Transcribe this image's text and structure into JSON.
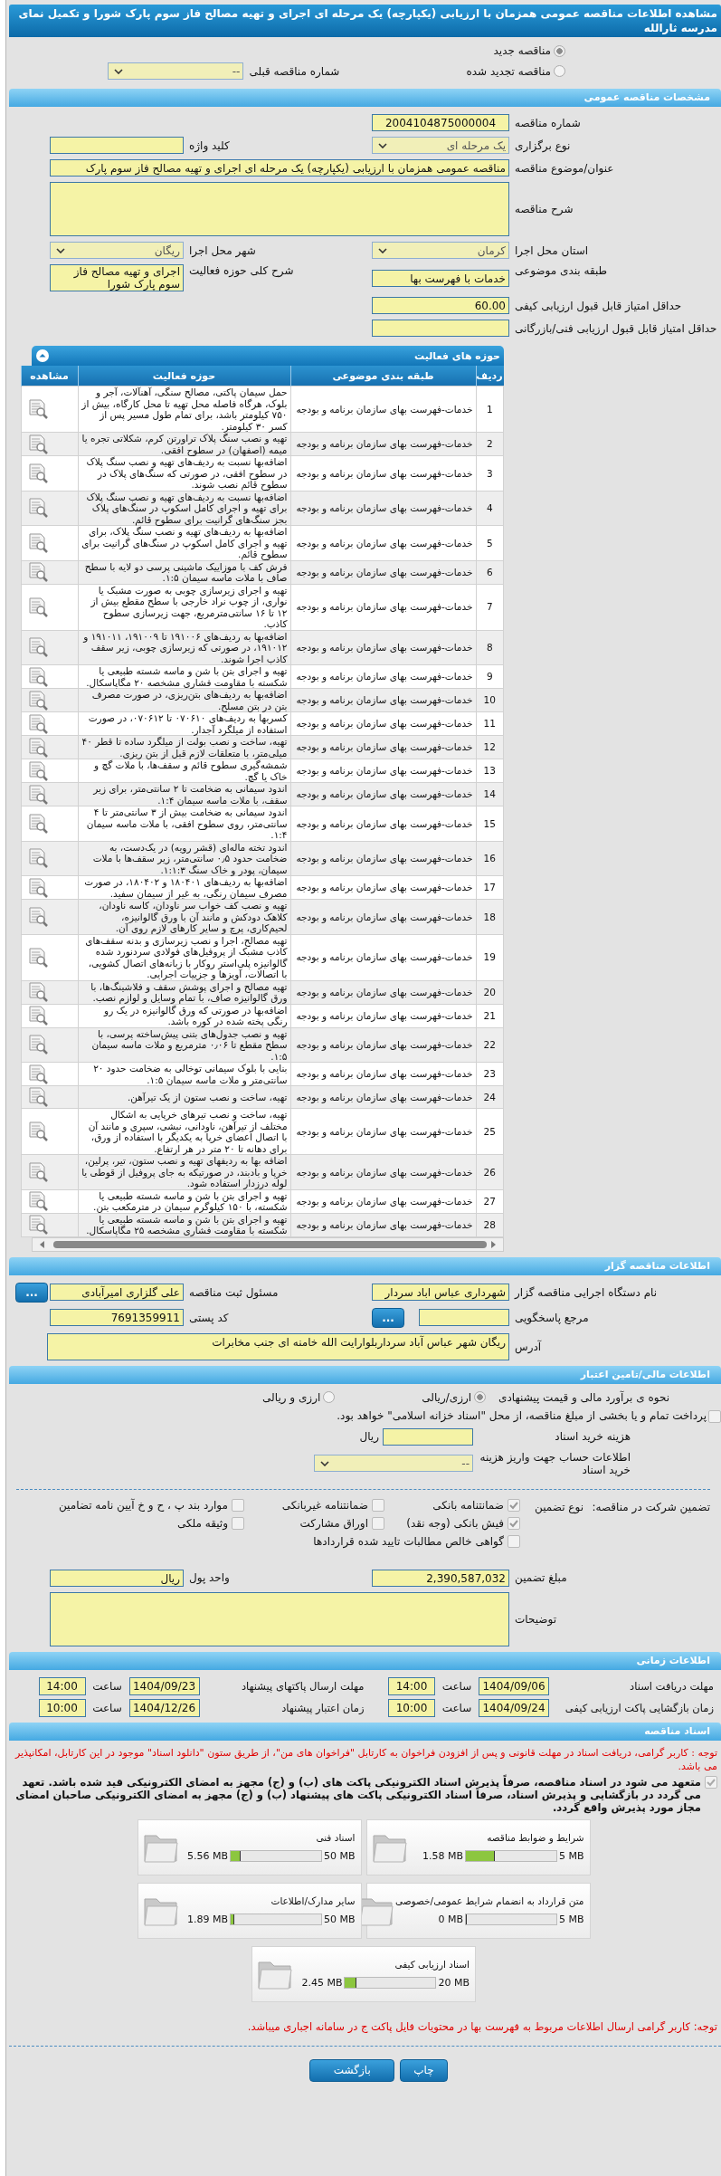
{
  "title": "مشاهده اطلاعات مناقصه عمومی همزمان با ارزیابی (یکپارچه) یک مرحله ای اجرای و تهیه مصالح فاز سوم پارک شورا و تکمیل نمای مدرسه ثارالله",
  "tender_kind": [
    {
      "label": "مناقصه جدید",
      "selected": true
    },
    {
      "label": "مناقصه تجدید شده",
      "selected": false
    }
  ],
  "previous_tender": {
    "label": "شماره مناقصه قبلی",
    "value": "--"
  },
  "general": {
    "title": "مشخصات مناقصه عمومی",
    "tender_number": {
      "label": "شماره مناقصه",
      "value": "2004104875000004"
    },
    "holding_type": {
      "label": "نوع برگزاری",
      "value": "یک مرحله ای"
    },
    "keyword": {
      "label": "کلید واژه"
    },
    "subject": {
      "label": "عنوان/موضوع مناقصه",
      "value": "مناقصه عمومی همزمان با ارزیابی (یکپارچه) یک مرحله ای اجرای و تهیه مصالح فاز سوم پارک"
    },
    "description": {
      "label": "شرح مناقصه"
    },
    "province": {
      "label": "استان محل اجرا",
      "value": "کرمان"
    },
    "city": {
      "label": "شهر محل اجرا",
      "value": "ریگان"
    },
    "category": {
      "label": "طبقه بندی موضوعی",
      "value": "خدمات با فهرست بها"
    },
    "activity_summary": {
      "label": "شرح کلی حوزه فعالیت",
      "value": "اجرای و تهیه مصالح فاز سوم پارک شورا"
    },
    "min_quality_score": {
      "label": "حداقل امتیاز قابل قبول ارزیابی کیفی",
      "value": "60.00"
    },
    "min_technical_score": {
      "label": "حداقل امتیاز قابل قبول ارزیابی فنی/بازرگانی"
    }
  },
  "activities": {
    "title": "حوزه های فعالیت",
    "columns": [
      "ردیف",
      "طبقه بندی موضوعی",
      "حوزه فعالیت",
      "مشاهده"
    ],
    "rows": [
      {
        "row": "1",
        "category": "خدمات-فهرست بهای سازمان برنامه و بودجه",
        "activity": "حمل سیمان پاکتی، مصالح سنگی، آهنآلات، آجر و بلوک، هرگاه فاصله محل تهیه تا محل کارگاه، بیش از ۷۵۰ کیلومتر باشد، برای تمام طول مسیر پس از کسر ۳۰ کیلومتر."
      },
      {
        "row": "2",
        "category": "خدمات-فهرست بهای سازمان برنامه و بودجه",
        "activity": "تهیه و نصب سنگ پلاک تراورتن کرم، شکلاتی تجره یا میمه (اصفهان) در سطوح افقی."
      },
      {
        "row": "3",
        "category": "خدمات-فهرست بهای سازمان برنامه و بودجه",
        "activity": "اضافه‌بها نسبت به ردیف‌های تهیه و نصب سنگ پلاک در سطوح افقی، در صورتی که سنگ‌های پلاک در سطوح قائم نصب شوند."
      },
      {
        "row": "4",
        "category": "خدمات-فهرست بهای سازمان برنامه و بودجه",
        "activity": "اضافه‌بها نسبت به ردیف‌های تهیه و نصب سنگ پلاک برای تهیه و اجرای کامل اسکوپ در سنگ‌های پلاک بجز سنگ‌های گرانیت برای سطوح قائم."
      },
      {
        "row": "5",
        "category": "خدمات-فهرست بهای سازمان برنامه و بودجه",
        "activity": "اضافه‌بها به ردیف‌های تهیه و نصب سنگ پلاک، برای تهیه و اجرای کامل اسکوپ در سنگ‌های گرانیت برای سطوح قائم."
      },
      {
        "row": "6",
        "category": "خدمات-فهرست بهای سازمان برنامه و بودجه",
        "activity": "فرش کف با موزاییک ماشینی پرسی دو لایه با سطح صاف با ملات ماسه سیمان ۱:۵."
      },
      {
        "row": "7",
        "category": "خدمات-فهرست بهای سازمان برنامه و بودجه",
        "activity": "تهیه و اجرای زیرسازی چوبی به صورت مشبک یا نواری، از چوب نراد خارجی با سطح مقطع بیش از ۱۲ تا ۱۶ سانتی‌مترمربع، جهت زیرسازی سطوح کاذب."
      },
      {
        "row": "8",
        "category": "خدمات-فهرست بهای سازمان برنامه و بودجه",
        "activity": "اضافه‌بها به ردیف‌های ۱۹۱۰۰۶ تا ۱۹۱۰۰۹، ۱۹۱۰۱۱ و ۱۹۱۰۱۲، در صورتی که زیرسازی چوبی، زیر سقف کاذب اجرا شوند."
      },
      {
        "row": "9",
        "category": "خدمات-فهرست بهای سازمان برنامه و بودجه",
        "activity": "تهیه و اجرای بتن با شن و ماسه شسته طبیعی یا شکسته با مقاومت فشاری مشخصه ۲۰ مگاپاسکال."
      },
      {
        "row": "10",
        "category": "خدمات-فهرست بهای سازمان برنامه و بودجه",
        "activity": "اضافه‌بها به ردیف‌های بتن‌ریزی، در صورت مصرف بتن در بتن مسلح."
      },
      {
        "row": "11",
        "category": "خدمات-فهرست بهای سازمان برنامه و بودجه",
        "activity": "کسربها به ردیف‌های ۰۷۰۶۱۰ تا ۰۷۰۶۱۲، در صورت استفاده از میلگرد آجدار."
      },
      {
        "row": "12",
        "category": "خدمات-فهرست بهای سازمان برنامه و بودجه",
        "activity": "تهیه، ساخت و نصب بولت از میلگرد ساده تا قطر ۴۰ میلی‌متر، با متعلقات لازم قبل از بتن ریزی."
      },
      {
        "row": "13",
        "category": "خدمات-فهرست بهای سازمان برنامه و بودجه",
        "activity": "شمشه‌گیری سطوح قائم و سقف‌ها، با ملات گچ و خاک یا گچ."
      },
      {
        "row": "14",
        "category": "خدمات-فهرست بهای سازمان برنامه و بودجه",
        "activity": "اندود سیمانی به ضخامت تا ۲ سانتی‌متر، برای زیر سقف، با ملات ماسه سیمان ۱:۴."
      },
      {
        "row": "15",
        "category": "خدمات-فهرست بهای سازمان برنامه و بودجه",
        "activity": "اندود سیمانی به ضخامت بیش از ۳ سانتی‌متر تا ۴ سانتی‌متر، روی سطوح افقی، با ملات ماسه سیمان ۱:۴."
      },
      {
        "row": "16",
        "category": "خدمات-فهرست بهای سازمان برنامه و بودجه",
        "activity": "اندود تخته ماله‌ای (قشر رویه) در یک‌دست، به ضخامت حدود ۰٫۵ سانتی‌متر، زیر سقف‌ها با ملات سیمان، پودر و خاک سنگ ۱:۱:۳."
      },
      {
        "row": "17",
        "category": "خدمات-فهرست بهای سازمان برنامه و بودجه",
        "activity": "اضافه‌بها به ردیف‌های ۱۸۰۴۰۱ و ۱۸۰۴۰۲، در صورت مصرف سیمان رنگی، به غیر از سیمان سفید."
      },
      {
        "row": "18",
        "category": "خدمات-فهرست بهای سازمان برنامه و بودجه",
        "activity": "تهیه و نصب کف خواب سر ناودان، کاسه ناودان، کلاهک دودکش و مانند آن با ورق گالوانیزه، لحیم‌کاری، پرچ و سایر کارهای لازم روی آن."
      },
      {
        "row": "19",
        "category": "خدمات-فهرست بهای سازمان برنامه و بودجه",
        "activity": "تهیه مصالح، اجرا و نصب زیرسازی و بدنه سقف‌های کاذب مشبک از پروفیل‌های فولادی سردنورد شده گالوانیزه پلی‌استر روکار با زبانه‌های اتصال کشویی، با اتصالات، آویزها و جزییات اجرایی."
      },
      {
        "row": "20",
        "category": "خدمات-فهرست بهای سازمان برنامه و بودجه",
        "activity": "تهیه مصالح و اجرای پوشش سقف و فلاشینگ‌ها، با ورق گالوانیزه صاف، با تمام وسایل و لوازم نصب."
      },
      {
        "row": "21",
        "category": "خدمات-فهرست بهای سازمان برنامه و بودجه",
        "activity": "اضافه‌بها در صورتی که ورق گالوانیزه در یک رو رنگی پخته شده در کوره باشد."
      },
      {
        "row": "22",
        "category": "خدمات-فهرست بهای سازمان برنامه و بودجه",
        "activity": "تهیه و نصب جدول‌های بتنی پیش‌ساخته پرسی، با سطح مقطع تا ۰٫۰۶ مترمربع و ملات ماسه سیمان ۱:۵."
      },
      {
        "row": "23",
        "category": "خدمات-فهرست بهای سازمان برنامه و بودجه",
        "activity": "بنایی با بلوک سیمانی توخالی به ضخامت حدود ۲۰ سانتی‌متر و ملات ماسه سیمان ۱:۵."
      },
      {
        "row": "24",
        "category": "خدمات-فهرست بهای سازمان برنامه و بودجه",
        "activity": "تهیه، ساخت و نصب ستون از یک تیرآهن."
      },
      {
        "row": "25",
        "category": "خدمات-فهرست بهای سازمان برنامه و بودجه",
        "activity": "تهیه، ساخت و نصب تیرهای خرپایی به اشکال مختلف از تیرآهن، ناودانی، نبشی، سپری و مانند آن با اتصال اعضای خرپا به یکدیگر با استفاده از ورق، برای دهانه تا ۲۰ متر در هر ارتفاع."
      },
      {
        "row": "26",
        "category": "خدمات-فهرست بهای سازمان برنامه و بودجه",
        "activity": "اضافه بها به ردیفهای تهیه و نصب ستون، تیر، پرلین، خرپا و بادبند، در صورتیکه به جای پروفیل از قوطی یا لوله درزدار استفاده شود."
      },
      {
        "row": "27",
        "category": "خدمات-فهرست بهای سازمان برنامه و بودجه",
        "activity": "تهیه و اجرای بتن با شن و ماسه شسته طبیعی یا شکسته، با ۱۵۰ کیلوگرم سیمان در مترمکعب بتن."
      },
      {
        "row": "28",
        "category": "خدمات-فهرست بهای سازمان برنامه و بودجه",
        "activity": "تهیه و اجرای بتن با شن و ماسه شسته طبیعی یا شکسته با مقاومت فشاری مشخصه ۲۵ مگاپاسکال."
      }
    ]
  },
  "organizer": {
    "title": "اطلاعات مناقصه گزار",
    "agency": {
      "label": "نام دستگاه اجرایی مناقصه گزار",
      "value": "شهرداری عباس اباد سردار"
    },
    "registrar": {
      "label": "مسئول ثبت مناقصه",
      "value": "علی گلزاری امیرآبادی",
      "button": "..."
    },
    "responder": {
      "label": "مرجع پاسخگویی",
      "button": "..."
    },
    "postal_code": {
      "label": "کد پستی",
      "value": "7691359911"
    },
    "address": {
      "label": "آدرس",
      "value": "ریگان شهر عباس آباد سرداربلوارایت الله خامنه ای جنب مخابرات"
    }
  },
  "finance": {
    "title": "اطلاعات مالی/تامین اعتبار",
    "estimate": {
      "label": "نحوه ی برآورد مالی و قیمت پیشنهادی",
      "options": [
        {
          "label": "ارزی/ریالی",
          "selected": true
        },
        {
          "label": "ارزی و ریالی",
          "selected": false
        }
      ]
    },
    "treasury": {
      "label": "پرداخت تمام و یا بخشی از مبلغ مناقصه، از محل \"اسناد خزانه اسلامی\" خواهد بود.",
      "checked": false
    },
    "doc_cost": {
      "label": "هزینه خرید اسناد",
      "unit": "ریال"
    },
    "account": {
      "label": "اطلاعات حساب جهت واریز هزینه خرید اسناد",
      "value": "--"
    },
    "guarantee": {
      "label": "تضمین شرکت در مناقصه:",
      "type_label": "نوع تضمین",
      "options": [
        {
          "label": "ضمانتنامه بانکی",
          "checked": true
        },
        {
          "label": "ضمانتنامه غیربانکی",
          "checked": false
        },
        {
          "label": "موارد بند پ ، ح و خ آیین نامه تضامین",
          "checked": false
        },
        {
          "label": "فیش بانکی (وجه نقد)",
          "checked": true
        },
        {
          "label": "اوراق مشارکت",
          "checked": false
        },
        {
          "label": "وثیقه ملکی",
          "checked": false
        },
        {
          "label": "گواهی خالص مطالبات تایید شده قراردادها",
          "checked": false
        }
      ]
    },
    "amount": {
      "label": "مبلغ تضمین",
      "value": "2,390,587,032"
    },
    "currency": {
      "label": "واحد پول",
      "value": "ریال"
    },
    "notes": {
      "label": "توضیحات"
    }
  },
  "timing": {
    "title": "اطلاعات زمانی",
    "items": [
      {
        "label": "مهلت دریافت اسناد",
        "date": "1404/09/06",
        "time_label": "ساعت",
        "time": "14:00"
      },
      {
        "label": "مهلت ارسال پاکتهای پیشنهاد",
        "date": "1404/09/23",
        "time_label": "ساعت",
        "time": "14:00"
      },
      {
        "label": "زمان بازگشایی پاکت ارزیابی کیفی",
        "date": "1404/09/24",
        "time_label": "ساعت",
        "time": "10:00"
      },
      {
        "label": "زمان اعتبار پیشنهاد",
        "date": "1404/12/26",
        "time_label": "ساعت",
        "time": "10:00"
      }
    ]
  },
  "documents": {
    "title": "اسناد مناقصه",
    "notice": "توجه : کاربر گرامی، دریافت اسناد در مهلت قانونی و پس از افزودن فراخوان به کارتابل \"فراخوان های من\"، از طریق ستون \"دانلود اسناد\" موجود در این کارتابل، امکانپذیر می باشد.",
    "commitment": {
      "text": "متعهد می شود در اسناد مناقصه، صرفاً پذیرش اسناد الکترونیکی پاکت های (ب) و (ج) مجهز به امضای الکترونیکی قید شده باشد. تعهد می گردد در بازگشایی و پذیرش اسناد، صرفاً اسناد الکترونیکی پاکت های پیشنهاد (ب) و (ج) مجهز به امضای الکترونیکی صاحبان امضای مجاز مورد پذیرش واقع گردد.",
      "checked": true
    },
    "files": [
      {
        "name": "شرایط و ضوابط مناقصه",
        "max": "5 MB",
        "size": "1.58 MB",
        "level": 0.316
      },
      {
        "name": "اسناد فنی",
        "max": "50 MB",
        "size": "5.56 MB",
        "level": 0.111
      },
      {
        "name": "متن قرارداد به انضمام شرایط عمومی/خصوصی",
        "max": "5 MB",
        "size": "0 MB",
        "level": 0
      },
      {
        "name": "سایر مدارک/اطلاعات",
        "max": "50 MB",
        "size": "1.89 MB",
        "level": 0.038
      },
      {
        "name": "اسناد ارزیابی کیفی",
        "max": "20 MB",
        "size": "2.45 MB",
        "level": 0.1225
      }
    ],
    "footer_notice": "توجه: کاربر گرامی ارسال اطلاعات مربوط به فهرست بها در محتویات فایل پاکت ج در سامانه اجباری میباشد."
  },
  "buttons": [
    "چاپ",
    "بازگشت"
  ]
}
